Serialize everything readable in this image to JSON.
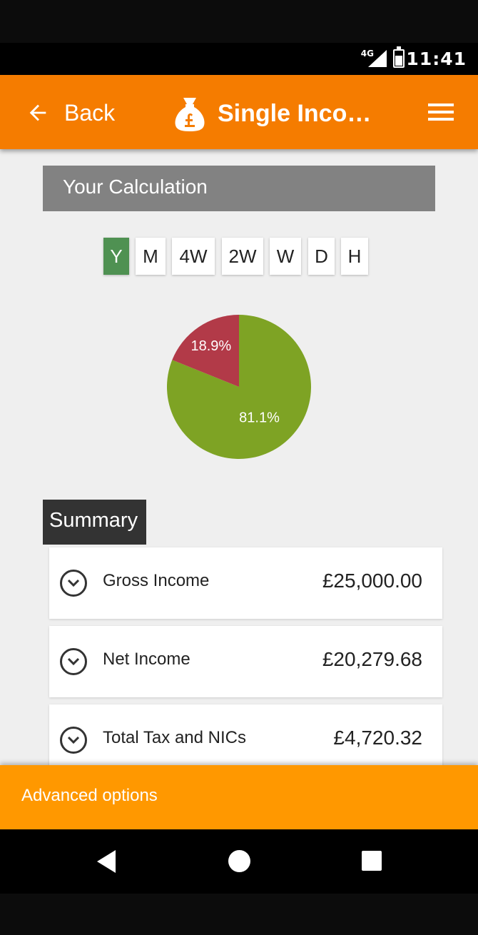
{
  "status_bar": {
    "network": "4G",
    "time": "11:41"
  },
  "app_bar": {
    "back_label": "Back",
    "title": "Single Inco…"
  },
  "calculation": {
    "header": "Your Calculation",
    "periods": [
      "Y",
      "M",
      "4W",
      "2W",
      "W",
      "D",
      "H"
    ],
    "selected_period": "Y"
  },
  "chart_data": {
    "type": "pie",
    "values": [
      81.1,
      18.9
    ],
    "labels": [
      "81.1%",
      "18.9%"
    ],
    "colors": [
      "#7ea324",
      "#b23a48"
    ]
  },
  "summary": {
    "tab_label": "Summary",
    "rows": [
      {
        "label": "Gross Income",
        "value": "£25,000.00"
      },
      {
        "label": "Net Income",
        "value": "£20,279.68"
      },
      {
        "label": "Total Tax and NICs",
        "value": "£4,720.32"
      }
    ]
  },
  "advanced": {
    "label": "Advanced options"
  },
  "colors": {
    "app_bar": "#f57c00",
    "advanced_bar": "#ff9800",
    "selected_period": "#4f9152",
    "calc_header": "#828282",
    "summary_tab": "#333333"
  }
}
